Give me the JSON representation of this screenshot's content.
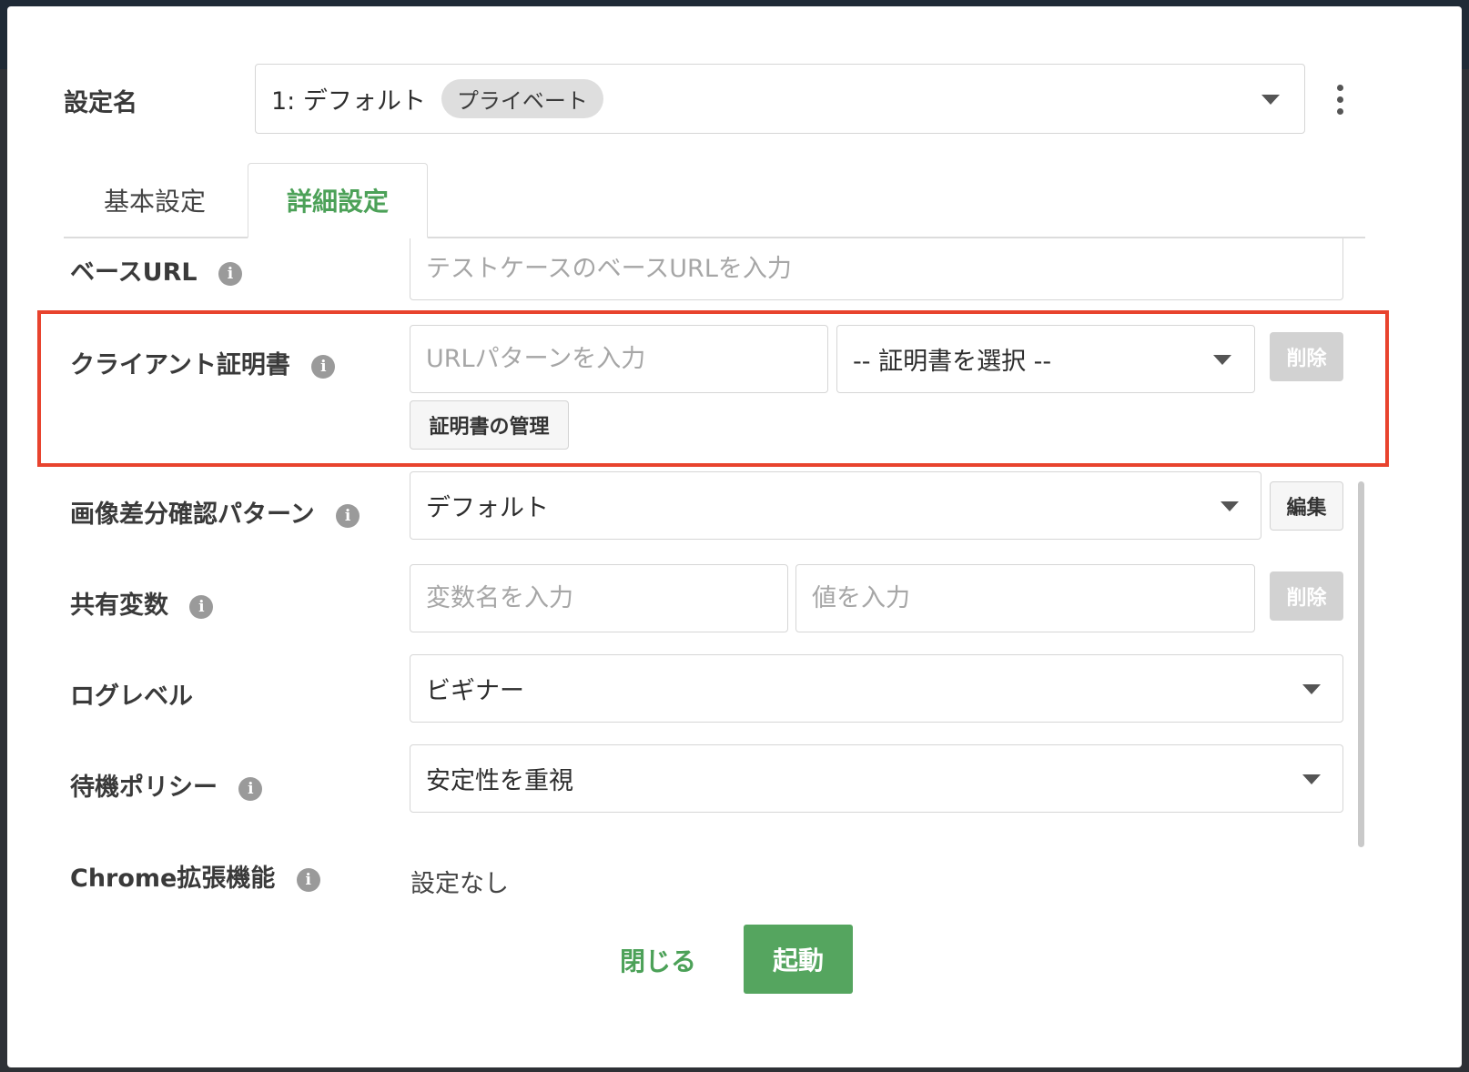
{
  "header": {
    "config_label": "設定名",
    "config_value": "1: デフォルト",
    "config_badge": "プライベート",
    "more_icon": "more-vertical-icon"
  },
  "tabs": [
    {
      "label": "基本設定",
      "active": false
    },
    {
      "label": "詳細設定",
      "active": true
    }
  ],
  "base_url": {
    "label": "ベースURL",
    "placeholder": "テストケースのベースURLを入力"
  },
  "client_cert": {
    "label": "クライアント証明書",
    "url_placeholder": "URLパターンを入力",
    "select_value": "-- 証明書を選択 --",
    "delete_label": "削除",
    "manage_label": "証明書の管理"
  },
  "image_diff": {
    "label": "画像差分確認パターン",
    "value": "デフォルト",
    "edit_label": "編集"
  },
  "shared_vars": {
    "label": "共有変数",
    "name_placeholder": "変数名を入力",
    "value_placeholder": "値を入力",
    "delete_label": "削除"
  },
  "log_level": {
    "label": "ログレベル",
    "value": "ビギナー"
  },
  "wait_policy": {
    "label": "待機ポリシー",
    "value": "安定性を重視"
  },
  "chrome_ext": {
    "label": "Chrome拡張機能",
    "value": "設定なし"
  },
  "footer": {
    "close_label": "閉じる",
    "start_label": "起動"
  },
  "colors": {
    "accent": "#4ca158",
    "highlight": "#e8432e",
    "primary_button": "#55a55f"
  }
}
